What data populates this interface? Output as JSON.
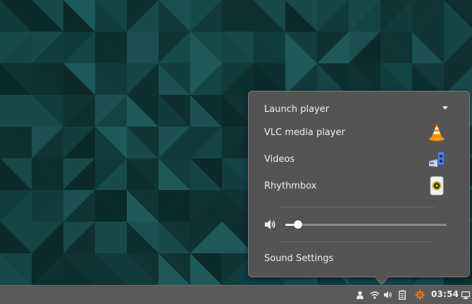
{
  "popup": {
    "launch_header": "Launch player",
    "apps": [
      {
        "label": "VLC media player",
        "icon": "vlc-cone-icon"
      },
      {
        "label": "Videos",
        "icon": "videos-projector-icon"
      },
      {
        "label": "Rhythmbox",
        "icon": "rhythmbox-speaker-icon"
      }
    ],
    "volume": {
      "icon": "speaker-volume-icon",
      "level": 0.08
    },
    "sound_settings": "Sound Settings"
  },
  "panel": {
    "tray_icons": [
      "user-icon",
      "wifi-icon",
      "volume-icon",
      "battery-clipboard-icon",
      "updates-burst-icon"
    ],
    "clock": "03:54",
    "display_icon": "display-icon"
  },
  "colors": {
    "desktop": "#123c3e",
    "popup_bg": "#545454",
    "panel_bg": "#5a5a5a",
    "text": "#eeeeee"
  }
}
